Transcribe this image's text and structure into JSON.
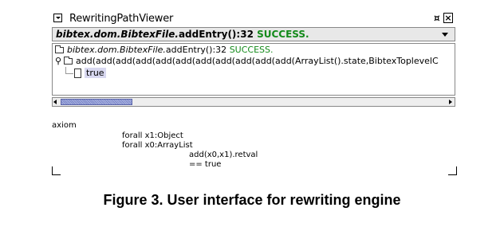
{
  "window": {
    "title": "RewritingPathViewer",
    "float_glyph": "¤",
    "close_glyph": "×"
  },
  "combo": {
    "class_path": "bibtex.dom.BibtexFile.",
    "method": "addEntry():32",
    "status": "SUCCESS."
  },
  "tree": {
    "root": {
      "class_path": "bibtex.dom.BibtexFile.",
      "method": "addEntry():32",
      "status": "SUCCESS."
    },
    "expression": "add(add(add(add(add(add(add(add(add(add(add(ArrayList().state,BibtexToplevelC",
    "expand_glyph": "⚲",
    "leaf": "true"
  },
  "axiom": {
    "lines": [
      "axiom",
      "forall x1:Object",
      "forall x0:ArrayList",
      "add(x0,x1).retval",
      "== true"
    ]
  },
  "caption": "Figure 3. User interface for rewriting engine",
  "colors": {
    "success": "#138a1a",
    "selection": "#d8d8f0",
    "scroll_thumb": "#7a86c8"
  }
}
